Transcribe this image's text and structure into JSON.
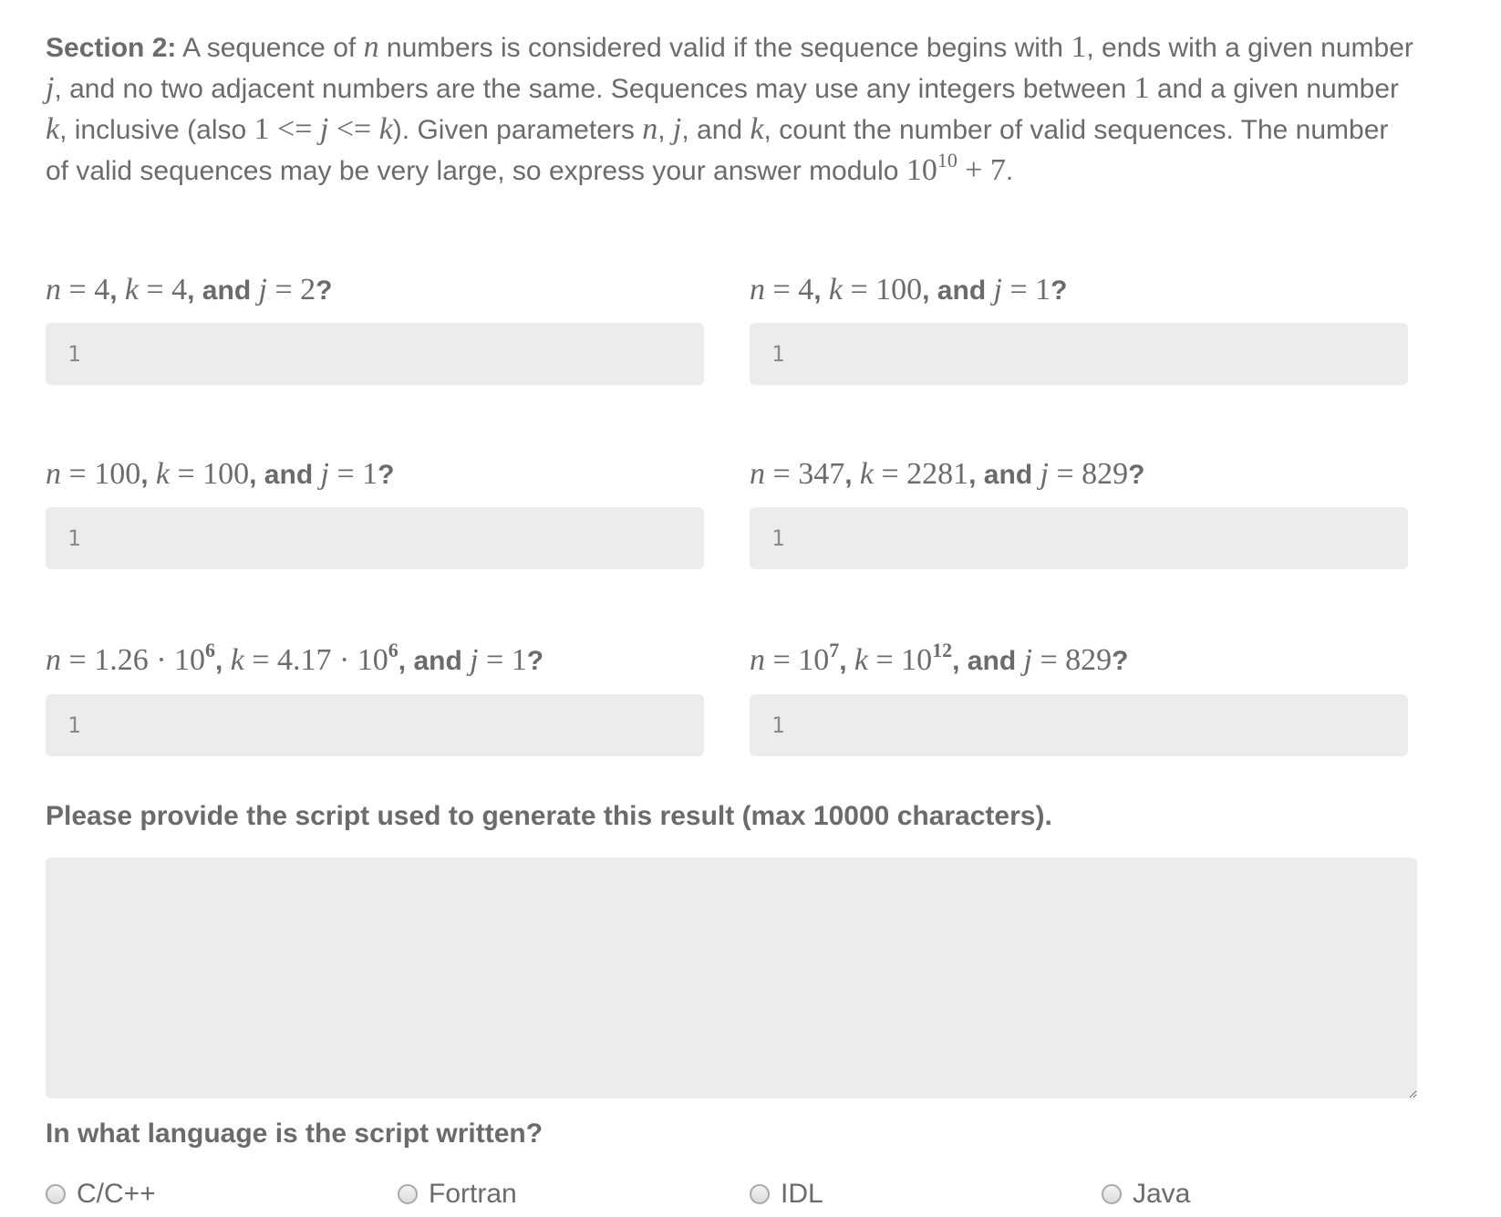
{
  "section": {
    "heading": "Section 2:",
    "t1": "A sequence of",
    "n": "n",
    "t2": "numbers is considered valid if the sequence begins with",
    "one": "1",
    "t3": ", ends with a given number",
    "j": "j",
    "t4": ", and no two adjacent numbers are the same. Sequences may use any integers between",
    "t5": "and a given number",
    "k": "k",
    "t6": ", inclusive (also",
    "ineq": "1 <= ",
    "ineq_mid": " <= ",
    "t7": "). Given parameters",
    "comma": ",",
    "t8": ", and",
    "t9": ", count the number of valid sequences. The number of valid sequences may be very large, so express your answer modulo",
    "mod_base": "10",
    "mod_exp": "10",
    "mod_tail": "+ 7",
    "period": "."
  },
  "questions": [
    {
      "n": "4",
      "k": "4",
      "j": "2",
      "answer": "1"
    },
    {
      "n": "4",
      "k": "100",
      "j": "1",
      "answer": "1"
    },
    {
      "n": "100",
      "k": "100",
      "j": "1",
      "answer": "1"
    },
    {
      "n": "347",
      "k": "2281",
      "j": "829",
      "answer": "1"
    },
    {
      "n_mant": "1.26 · 10",
      "n_exp": "6",
      "k_mant": "4.17 · 10",
      "k_exp": "6",
      "j": "1",
      "answer": "1"
    },
    {
      "n_mant": "10",
      "n_exp": "7",
      "k_mant": "10",
      "k_exp": "12",
      "j": "829",
      "answer": "1"
    }
  ],
  "labels": {
    "eq": " = ",
    "sep": ", ",
    "and": ", and ",
    "qmark": "?",
    "script_prompt": "Please provide the script used to generate this result (max 10000 characters).",
    "language_prompt": "In what language is the script written?"
  },
  "script": {
    "value": ""
  },
  "languages": [
    "C/C++",
    "Fortran",
    "IDL",
    "Java"
  ]
}
